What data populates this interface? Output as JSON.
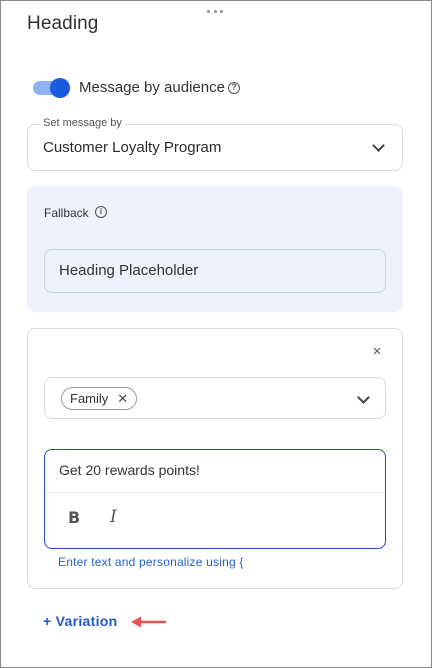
{
  "panel": {
    "title": "Heading"
  },
  "audience_toggle": {
    "label": "Message by audience",
    "enabled": true,
    "help_icon": "help-circle-icon"
  },
  "set_message_by": {
    "legend": "Set message by",
    "value": "Customer Loyalty Program",
    "icon": "chevron-down-icon"
  },
  "fallback": {
    "label": "Fallback",
    "info_icon": "info-icon",
    "value": "Heading Placeholder"
  },
  "variation": {
    "close_icon": "close-icon",
    "tags": [
      "Family"
    ],
    "tag_remove_glyph": "✕",
    "editor_text": "Get 20 rewards points!",
    "toolbar": {
      "bold": "B",
      "italic": "I"
    },
    "helper_text": "Enter text and personalize using {"
  },
  "add_variation": {
    "label": "+ Variation",
    "annotation": "red-arrow-icon"
  },
  "colors": {
    "accent": "#1a5be0",
    "toggle_track": "#8fb3f2",
    "link": "#2158c3",
    "fallback_bg": "#edf2fd",
    "annotation_arrow": "#e8524f"
  }
}
